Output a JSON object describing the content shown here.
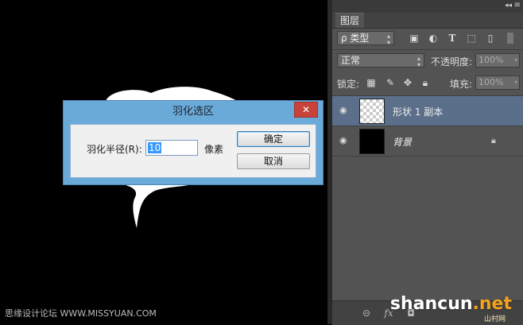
{
  "panel": {
    "tab_label": "图层",
    "filter_label": "ρ 类型",
    "blend_mode": "正常",
    "opacity_label": "不透明度:",
    "opacity_value": "100%",
    "lock_label": "锁定:",
    "fill_label": "填充:",
    "fill_value": "100%",
    "layers": [
      {
        "name": "形状 1 副本",
        "selected": true
      },
      {
        "name": "背景",
        "selected": false
      }
    ]
  },
  "dialog": {
    "title": "羽化选区",
    "close_label": "✕",
    "radius_label": "羽化半径(R):",
    "radius_value": "10",
    "unit": "像素",
    "ok_label": "确定",
    "cancel_label": "取消"
  },
  "watermark": {
    "left_text": "思缘设计论坛 WWW.MISSYUAN.COM",
    "right_text": "shancun",
    "right_suffix": ".net",
    "right_sub": "山村网"
  },
  "icons": {
    "panel_menu": "panel-menu-icon",
    "collapse": "double-arrow-icon",
    "eye": "eye-icon",
    "lock": "lock-icon"
  },
  "colors": {
    "dialog_title_bar": "#6aaad8",
    "close_button": "#c7433a",
    "selected_layer": "#5b6f8a",
    "panel_bg": "#535353"
  }
}
